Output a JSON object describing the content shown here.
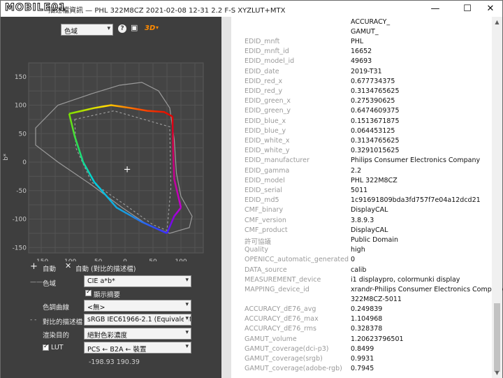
{
  "titlebar": {
    "watermark": "MOBILE01",
    "title": "描述檔資訊 — PHL 322M8CZ 2021-02-08 12-31 2.2 F-S XYZLUT+MTX",
    "minimize": "—",
    "maximize": "☐",
    "close": "✕"
  },
  "toolbar": {
    "view_select": "色域",
    "help_icon": "?",
    "image_icon": "▣",
    "mode_3d": "3D"
  },
  "plot": {
    "xlabel": "a*",
    "ylabel": "b*",
    "x_ticks": [
      "-150",
      "-100",
      "-50",
      "0",
      "50",
      "100"
    ],
    "y_ticks": [
      "150",
      "100",
      "50",
      "0",
      "-50",
      "-100",
      "-150"
    ],
    "crosshair": "+"
  },
  "zoom": {
    "zoom_in": "自動",
    "zoom_out": "自動 (對比的描述檔)"
  },
  "controls": {
    "gamut_label": "色域",
    "gamut_value": "CIE a*b*",
    "show_summary": "顯示摘要",
    "tone_curve_label": "色調曲線",
    "tone_curve_value": "<無>",
    "compare_label": "對比的描述檔",
    "compare_value": "sRGB IEC61966-2.1 (Equivalent to",
    "intent_label": "渲染目的",
    "intent_value": "絕對色彩濃度",
    "lut_label": "LUT",
    "lut_value": "PCS ← B2A ← 裝置",
    "coords": "-198.93 190.39"
  },
  "info_top": [
    "ACCURACY_",
    "GAMUT_"
  ],
  "info_rows": [
    {
      "key": "EDID_mnft",
      "value": "PHL"
    },
    {
      "key": "EDID_mnft_id",
      "value": "16652"
    },
    {
      "key": "EDID_model_id",
      "value": "49693"
    },
    {
      "key": "EDID_date",
      "value": "2019-T31"
    },
    {
      "key": "EDID_red_x",
      "value": "0.677734375"
    },
    {
      "key": "EDID_red_y",
      "value": "0.3134765625"
    },
    {
      "key": "EDID_green_x",
      "value": "0.275390625"
    },
    {
      "key": "EDID_green_y",
      "value": "0.6474609375"
    },
    {
      "key": "EDID_blue_x",
      "value": "0.1513671875"
    },
    {
      "key": "EDID_blue_y",
      "value": "0.064453125"
    },
    {
      "key": "EDID_white_x",
      "value": "0.3134765625"
    },
    {
      "key": "EDID_white_y",
      "value": "0.3291015625"
    },
    {
      "key": "EDID_manufacturer",
      "value": "Philips Consumer Electronics Company"
    },
    {
      "key": "EDID_gamma",
      "value": "2.2"
    },
    {
      "key": "EDID_model",
      "value": "PHL 322M8CZ"
    },
    {
      "key": "EDID_serial",
      "value": "5011"
    },
    {
      "key": "EDID_md5",
      "value": "1c91691809bda3fd757f7e04a12dcd21"
    },
    {
      "key": "CMF_binary",
      "value": "DisplayCAL"
    },
    {
      "key": "CMF_version",
      "value": "3.8.9.3"
    },
    {
      "key": "CMF_product",
      "value": "DisplayCAL"
    },
    {
      "key": "許可協議",
      "value": "Public Domain"
    },
    {
      "key": "Quality",
      "value": "high"
    },
    {
      "key": "OPENICC_automatic_generated",
      "value": "0"
    },
    {
      "key": "DATA_source",
      "value": "calib"
    },
    {
      "key": "MEASUREMENT_device",
      "value": "i1 displaypro, colormunki display"
    },
    {
      "key": "MAPPING_device_id",
      "value": "xrandr-Philips Consumer Electronics Company-PH"
    }
  ],
  "info_cont": "322M8CZ-5011",
  "info_rows2": [
    {
      "key": "ACCURACY_dE76_avg",
      "value": "0.249839"
    },
    {
      "key": "ACCURACY_dE76_max",
      "value": "1.104968"
    },
    {
      "key": "ACCURACY_dE76_rms",
      "value": "0.328378"
    },
    {
      "key": "GAMUT_volume",
      "value": "1.20623796501"
    },
    {
      "key": "GAMUT_coverage(dci-p3)",
      "value": "0.8499"
    },
    {
      "key": "GAMUT_coverage(srgb)",
      "value": "0.9931"
    },
    {
      "key": "GAMUT_coverage(adobe-rgb)",
      "value": "0.7945"
    }
  ]
}
